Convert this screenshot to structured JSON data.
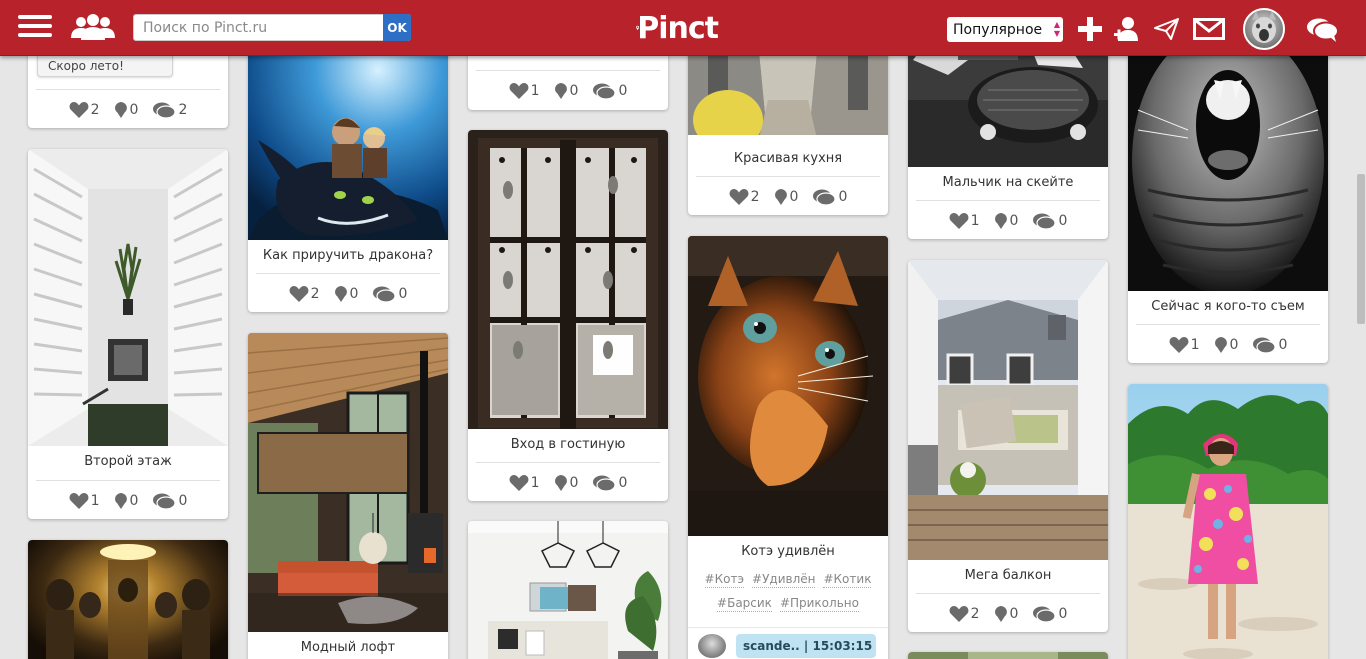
{
  "header": {
    "search_placeholder": "Поиск по Pinct.ru",
    "search_button": "OK",
    "logo": "Pinct",
    "sort_selected": "Популярное",
    "icons": [
      "menu-icon",
      "people-icon",
      "plus-icon",
      "add-user-icon",
      "paper-plane-icon",
      "mail-icon",
      "chat-icon"
    ]
  },
  "pins": [
    {
      "tooltip": "Скоро лето!",
      "likes": "2",
      "reposts": "0",
      "comments": "2"
    },
    {
      "caption": "Второй этаж",
      "likes": "1",
      "reposts": "0",
      "comments": "0"
    },
    {
      "caption": ""
    },
    {
      "caption": "Как приручить дракона?",
      "likes": "2",
      "reposts": "0",
      "comments": "0"
    },
    {
      "caption": "Модный лофт"
    },
    {
      "likes": "1",
      "reposts": "0",
      "comments": "0"
    },
    {
      "caption": "Вход в гостиную",
      "likes": "1",
      "reposts": "0",
      "comments": "0"
    },
    {
      "caption": ""
    },
    {
      "caption": "Красивая кухня",
      "likes": "2",
      "reposts": "0",
      "comments": "0"
    },
    {
      "caption": "Котэ удивлён",
      "tags": [
        "#Котэ",
        "#Удивлён",
        "#Котик",
        "#Барсик",
        "#Прикольно"
      ],
      "comment_preview": "scande.. | 15:03:15"
    },
    {
      "caption": "Мальчик на скейте",
      "likes": "1",
      "reposts": "0",
      "comments": "0"
    },
    {
      "caption": "Мега балкон",
      "likes": "2",
      "reposts": "0",
      "comments": "0"
    },
    {
      "caption": ""
    },
    {
      "caption": "Сейчас я кого-то съем",
      "likes": "1",
      "reposts": "0",
      "comments": "0"
    },
    {
      "caption": ""
    }
  ],
  "colors": {
    "header": "#b8222b",
    "ok_button": "#2d6fc4",
    "accent": "#d0267a"
  }
}
